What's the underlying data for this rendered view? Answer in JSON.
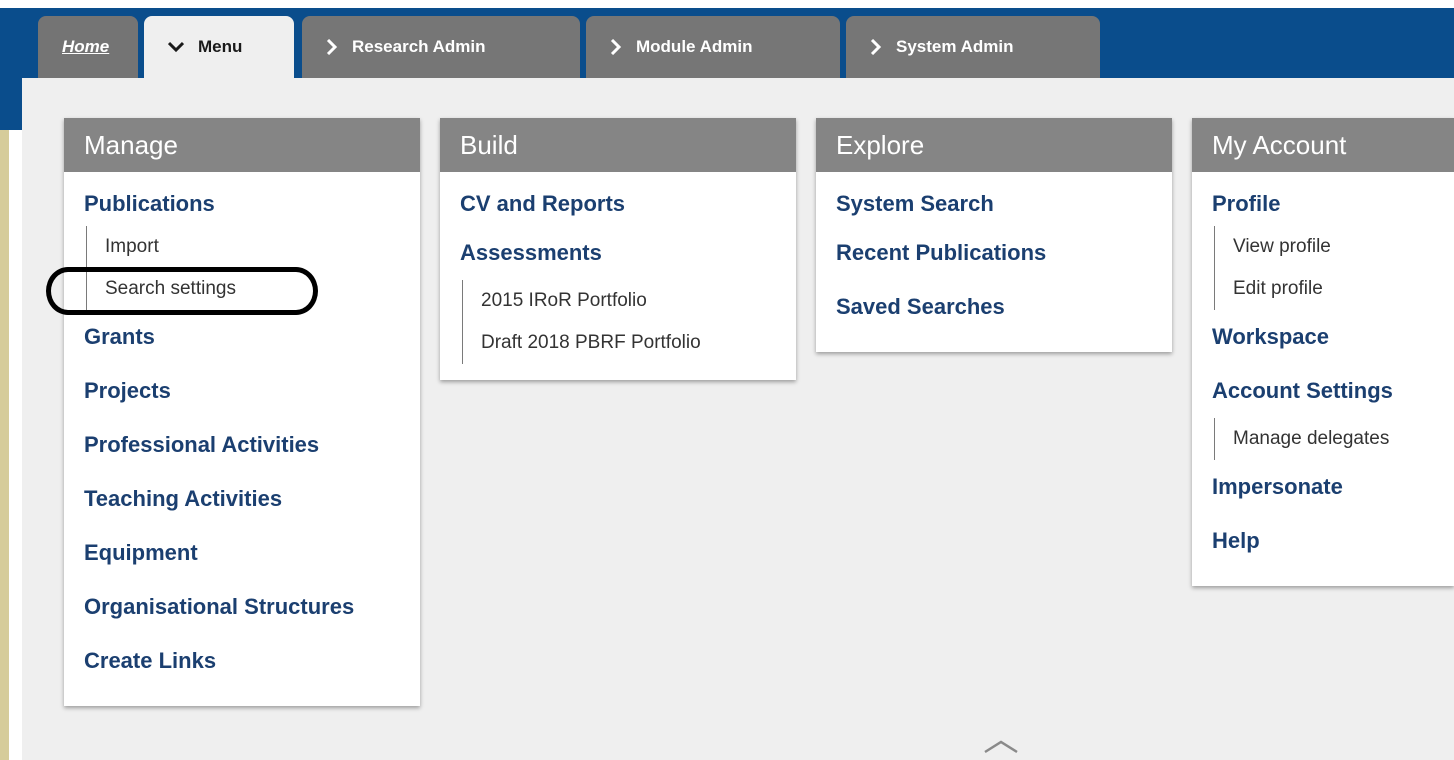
{
  "tabs": [
    {
      "label": "Home"
    },
    {
      "label": "Menu"
    },
    {
      "label": "Research Admin"
    },
    {
      "label": "Module Admin"
    },
    {
      "label": "System Admin"
    }
  ],
  "icons": {
    "active_tab": "chevron-down-icon",
    "tab": "chevron-right-icon",
    "collapse": "chevron-up-icon"
  },
  "manage": {
    "title": "Manage",
    "publications": "Publications",
    "import": "Import",
    "search_settings": "Search settings",
    "grants": "Grants",
    "projects": "Projects",
    "professional_activities": "Professional Activities",
    "teaching_activities": "Teaching Activities",
    "equipment": "Equipment",
    "organisational_structures": "Organisational Structures",
    "create_links": "Create Links"
  },
  "build": {
    "title": "Build",
    "cv_reports": "CV and Reports",
    "assessments": "Assessments",
    "portfolio_2015": "2015 IRoR Portfolio",
    "portfolio_2018": "Draft 2018 PBRF Portfolio"
  },
  "explore": {
    "title": "Explore",
    "system_search": "System Search",
    "recent_publications": "Recent Publications",
    "saved_searches": "Saved Searches"
  },
  "account": {
    "title": "My Account",
    "profile": "Profile",
    "view_profile": "View profile",
    "edit_profile": "Edit profile",
    "workspace": "Workspace",
    "account_settings": "Account Settings",
    "manage_delegates": "Manage delegates",
    "impersonate": "Impersonate",
    "help": "Help"
  },
  "colors": {
    "topbar": "#0a4d8c",
    "link": "#1b3f70",
    "panel_header": "#858585",
    "content_bg": "#efefef"
  }
}
